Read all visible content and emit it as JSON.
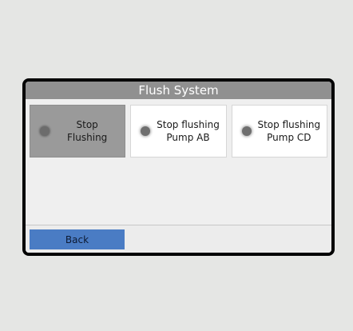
{
  "window": {
    "title": "Flush System"
  },
  "buttons": [
    {
      "label": "Stop\nFlushing",
      "active": true
    },
    {
      "label": "Stop flushing\nPump AB",
      "active": false
    },
    {
      "label": "Stop flushing\nPump CD",
      "active": false
    }
  ],
  "footer": {
    "back_label": "Back"
  },
  "colors": {
    "title_bar": "#909090",
    "active_button": "#9a9a9a",
    "back_button": "#4a7cc4"
  },
  "icons": [
    "status-indicator-icon"
  ]
}
